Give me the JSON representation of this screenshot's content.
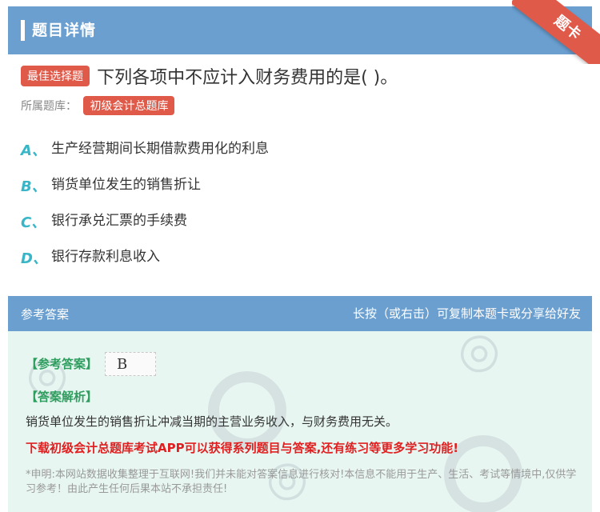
{
  "header": {
    "title": "题目详情",
    "ribbon_label": "题卡"
  },
  "question": {
    "type_tag": "最佳选择题",
    "text": "下列各项中不应计入财务费用的是( )。",
    "bank_label": "所属题库：",
    "bank_name": "初级会计总题库"
  },
  "options": [
    {
      "letter": "A、",
      "text": "生产经营期间长期借款费用化的利息"
    },
    {
      "letter": "B、",
      "text": "销货单位发生的销售折让"
    },
    {
      "letter": "C、",
      "text": "银行承兑汇票的手续费"
    },
    {
      "letter": "D、",
      "text": "银行存款利息收入"
    }
  ],
  "answer": {
    "section_title": "参考答案",
    "share_hint": "长按（或右击）可复制本题卡或分享给好友",
    "answer_label": "【参考答案】",
    "answer_value": "B",
    "analysis_label": "【答案解析】",
    "analysis_text": "销货单位发生的销售折让冲减当期的主营业务收入，与财务费用无关。",
    "promo": "下载初级会计总题库考试APP可以获得系列题目与答案,还有练习等更多学习功能!",
    "disclaimer": "*申明:本网站数据收集整理于互联网!我们并未能对答案信息进行核对!本信息不能用于生产、生活、考试等情境中,仅供学习参考！由此产生任何后果本站不承担责任!"
  },
  "colors": {
    "header_blue": "#6a9fd0",
    "accent_red": "#e05a4a",
    "option_teal": "#38b6c8",
    "answer_green": "#2e9e5e",
    "promo_red": "#e02020",
    "answer_bg": "#e8f6f2"
  }
}
